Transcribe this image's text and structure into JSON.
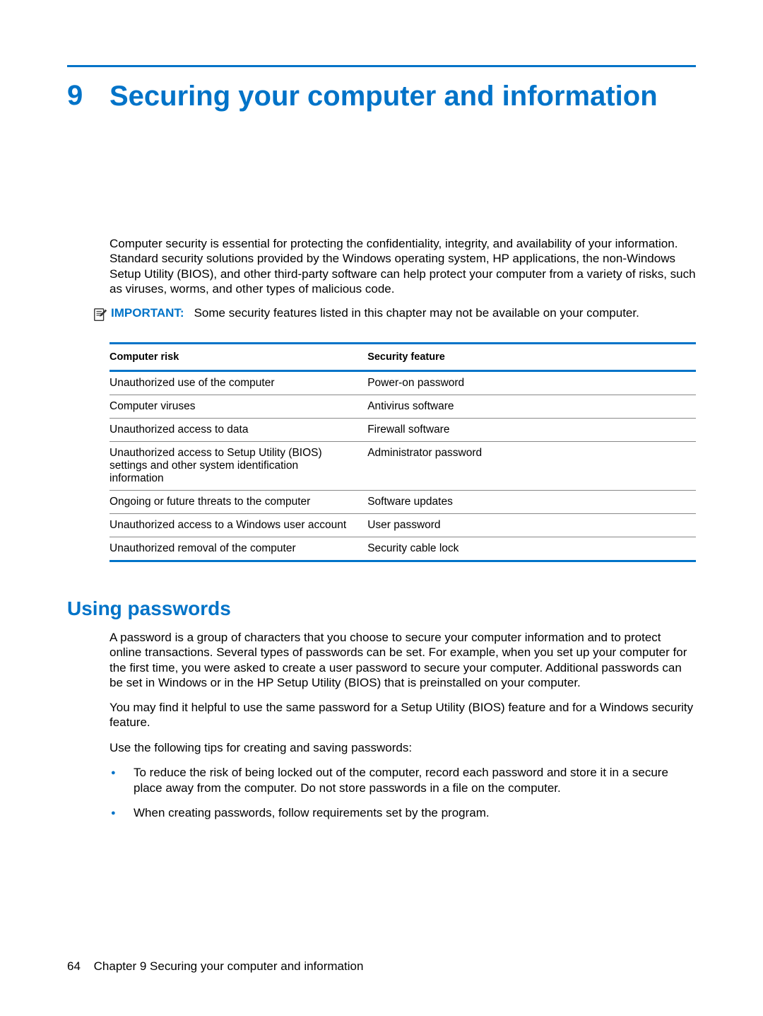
{
  "chapter": {
    "number": "9",
    "title": "Securing your computer and information"
  },
  "intro_paragraph": "Computer security is essential for protecting the confidentiality, integrity, and availability of your information. Standard security solutions provided by the Windows operating system, HP applications, the non-Windows Setup Utility (BIOS), and other third-party software can help protect your computer from a variety of risks, such as viruses, worms, and other types of malicious code.",
  "important": {
    "label": "IMPORTANT:",
    "text": "Some security features listed in this chapter may not be available on your computer."
  },
  "table": {
    "headers": {
      "risk": "Computer risk",
      "feature": "Security feature"
    },
    "rows": [
      {
        "risk": "Unauthorized use of the computer",
        "feature": "Power-on password"
      },
      {
        "risk": "Computer viruses",
        "feature": "Antivirus software"
      },
      {
        "risk": "Unauthorized access to data",
        "feature": "Firewall software"
      },
      {
        "risk": "Unauthorized access to Setup Utility (BIOS) settings and other system identification information",
        "feature": "Administrator password"
      },
      {
        "risk": "Ongoing or future threats to the computer",
        "feature": "Software updates"
      },
      {
        "risk": "Unauthorized access to a Windows user account",
        "feature": "User password"
      },
      {
        "risk": "Unauthorized removal of the computer",
        "feature": "Security cable lock"
      }
    ]
  },
  "section": {
    "heading": "Using passwords",
    "p1": "A password is a group of characters that you choose to secure your computer information and to protect online transactions. Several types of passwords can be set. For example, when you set up your computer for the first time, you were asked to create a user password to secure your computer. Additional passwords can be set in Windows or in the HP Setup Utility (BIOS) that is preinstalled on your computer.",
    "p2": "You may find it helpful to use the same password for a Setup Utility (BIOS) feature and for a Windows security feature.",
    "p3": "Use the following tips for creating and saving passwords:",
    "tips": [
      "To reduce the risk of being locked out of the computer, record each password and store it in a secure place away from the computer. Do not store passwords in a file on the computer.",
      "When creating passwords, follow requirements set by the program."
    ]
  },
  "footer": {
    "page": "64",
    "label": "Chapter 9   Securing your computer and information"
  }
}
